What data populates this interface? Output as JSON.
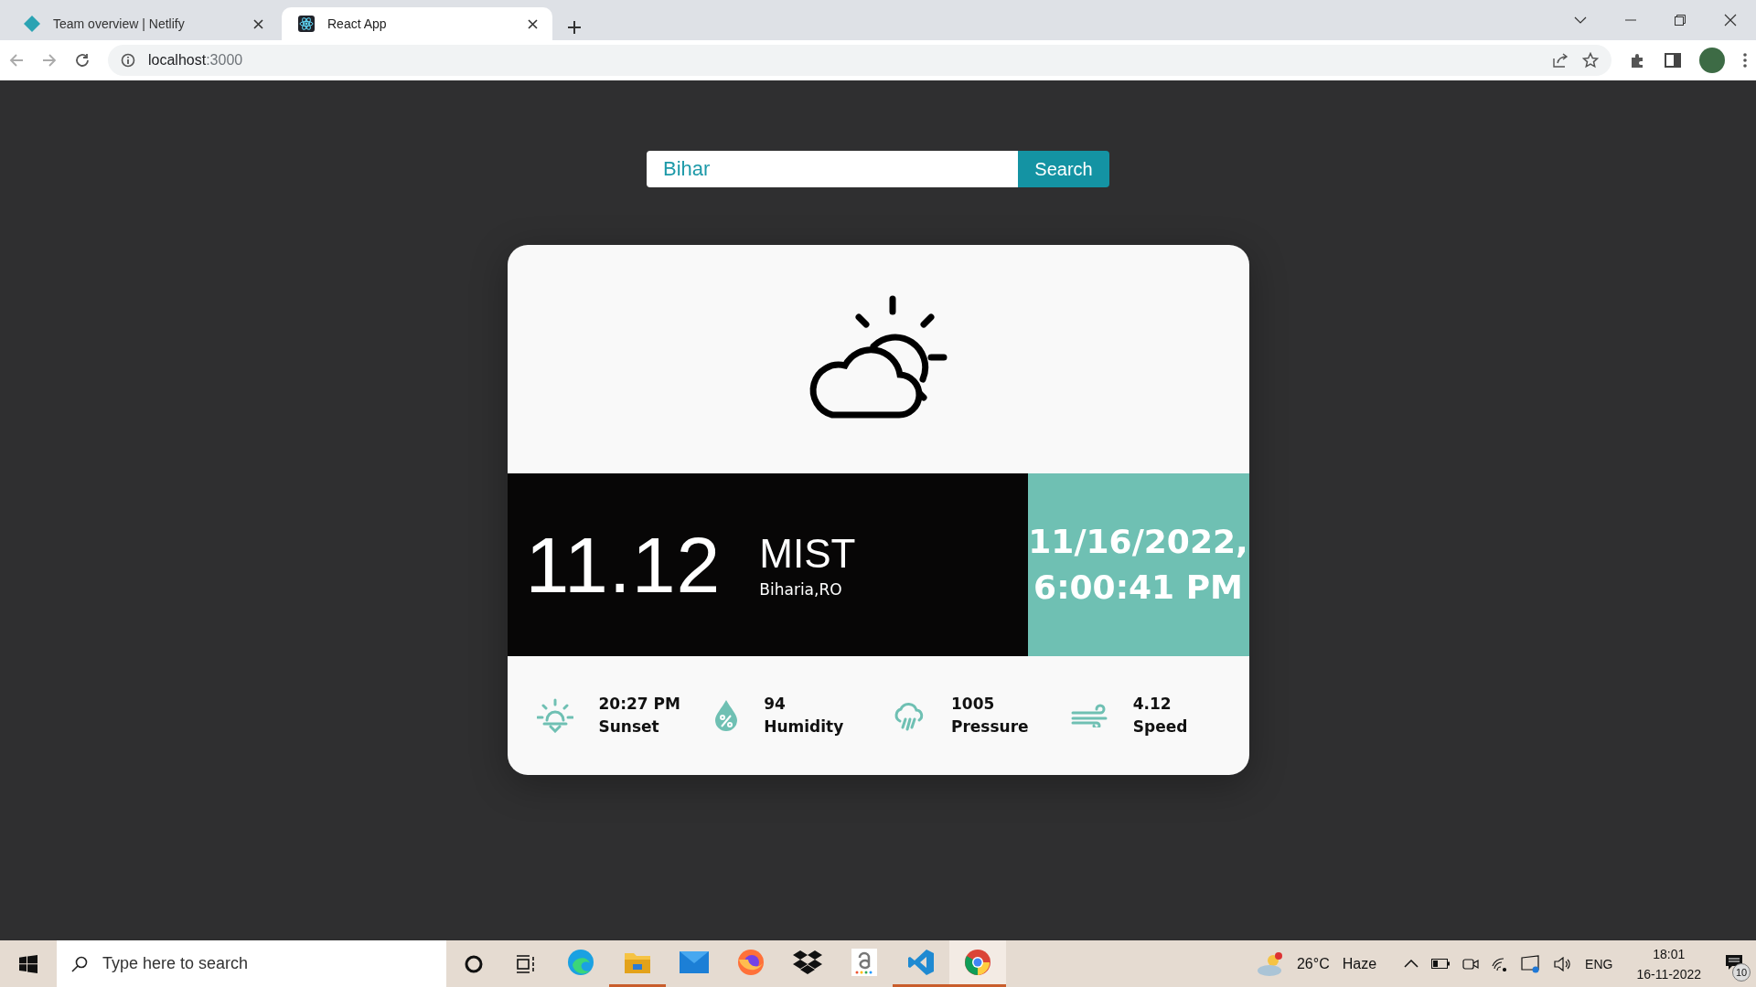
{
  "browser": {
    "tabs": [
      {
        "kind": "netlify",
        "title": "Team overview | Netlify",
        "selected": false
      },
      {
        "kind": "react",
        "title": "React App",
        "selected": true
      }
    ],
    "address": {
      "host": "localhost",
      "rest": ":3000"
    }
  },
  "search": {
    "value": "Bihar",
    "button": "Search"
  },
  "weather": {
    "temperature": "11.12",
    "condition": "MIST",
    "location": "Biharia,RO",
    "datetime": [
      "11/16/2022,",
      "6:00:41 PM"
    ],
    "stats": [
      {
        "kind": "sunset",
        "value": "20:27 PM",
        "label": "Sunset"
      },
      {
        "kind": "humidity",
        "value": "94",
        "label": "Humidity"
      },
      {
        "kind": "pressure",
        "value": "1005",
        "label": "Pressure"
      },
      {
        "kind": "wind",
        "value": "4.12",
        "label": "Speed"
      }
    ]
  },
  "taskbar": {
    "search_placeholder": "Type here to search",
    "apps": [
      {
        "kind": "edge",
        "running": false,
        "selected": false
      },
      {
        "kind": "explorer",
        "running": true,
        "selected": false
      },
      {
        "kind": "mail",
        "running": false,
        "selected": false
      },
      {
        "kind": "firefox",
        "running": false,
        "selected": false
      },
      {
        "kind": "dropbox",
        "running": false,
        "selected": false
      },
      {
        "kind": "amazon",
        "running": false,
        "selected": false
      },
      {
        "kind": "vscode",
        "running": true,
        "selected": false
      },
      {
        "kind": "chrome",
        "running": true,
        "selected": true
      }
    ],
    "weather": {
      "temperature": "26°C",
      "condition": "Haze"
    },
    "language": "ENG",
    "time": "18:01",
    "date": "16-11-2022",
    "notifications": "10"
  }
}
